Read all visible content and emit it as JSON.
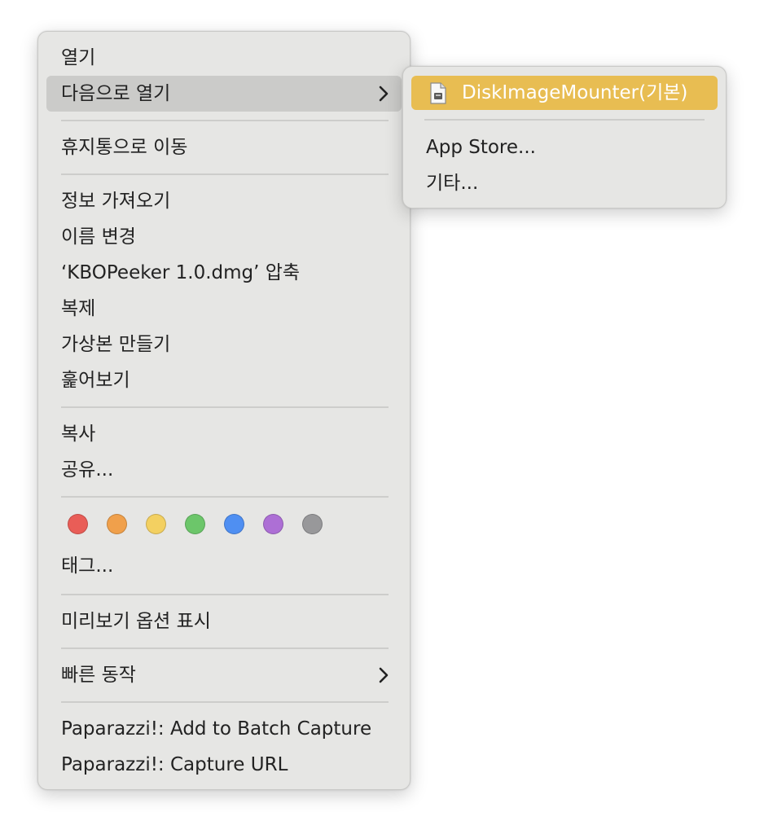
{
  "context_menu": {
    "items": {
      "open": "열기",
      "open_with": "다음으로 열기",
      "move_to_trash": "휴지통으로 이동",
      "get_info": "정보 가져오기",
      "rename": "이름 변경",
      "compress": "‘KBOPeeker 1.0.dmg’ 압축",
      "duplicate": "복제",
      "make_alias": "가상본 만들기",
      "quick_look": "훑어보기",
      "copy": "복사",
      "share": "공유...",
      "tags": "태그...",
      "show_preview_options": "미리보기 옵션 표시",
      "quick_actions": "빠른 동작",
      "paparazzi_batch": "Paparazzi!: Add to Batch Capture",
      "paparazzi_capture_url": "Paparazzi!: Capture URL"
    },
    "chevron_icon": "chevron-right-icon",
    "tag_colors": [
      {
        "name": "red",
        "color": "#e95d57"
      },
      {
        "name": "orange",
        "color": "#f0a04b"
      },
      {
        "name": "yellow",
        "color": "#f3d061"
      },
      {
        "name": "green",
        "color": "#6cc66a"
      },
      {
        "name": "blue",
        "color": "#4f8ff2"
      },
      {
        "name": "purple",
        "color": "#ad6fd5"
      },
      {
        "name": "gray",
        "color": "#98989a"
      }
    ]
  },
  "open_with_submenu": {
    "default_app": "DiskImageMounter(기본)",
    "default_app_icon": "disk-image-file-icon",
    "app_store": "App Store...",
    "other": "기타...",
    "highlight_color": "#e8bd52"
  },
  "colors": {
    "menu_background": "#e6e6e4",
    "hover_background": "#cbcbc9",
    "text": "#222222",
    "selected_text": "#ffffff"
  }
}
